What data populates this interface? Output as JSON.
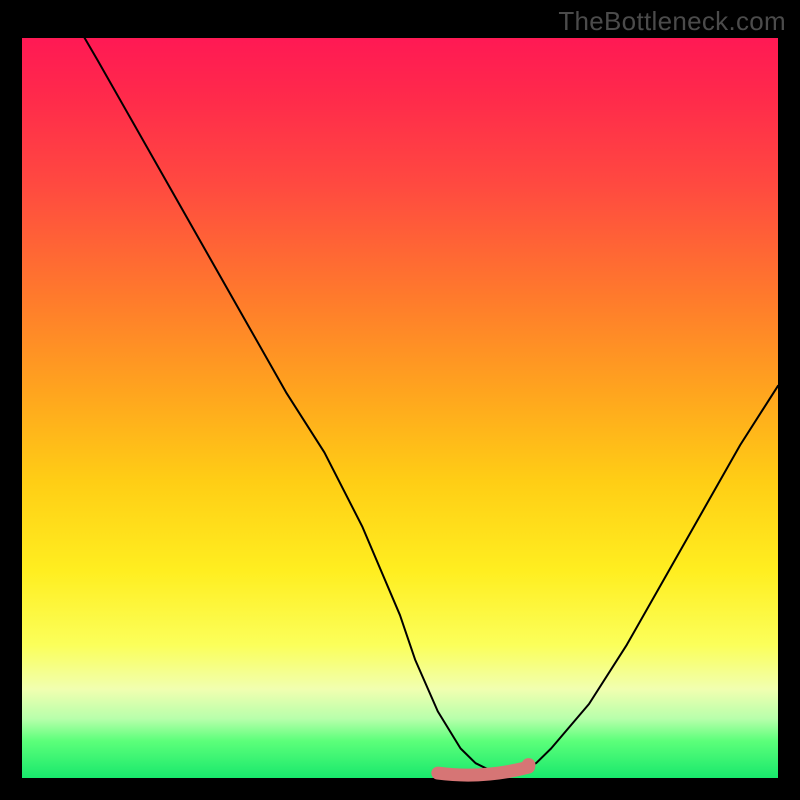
{
  "watermark": "TheBottleneck.com",
  "colors": {
    "gradient_top": "#ff1954",
    "gradient_mid": "#ffce15",
    "gradient_bottom": "#18e86c",
    "curve": "#000000",
    "plateau": "#d67575",
    "frame": "#000000"
  },
  "chart_data": {
    "type": "line",
    "title": "",
    "xlabel": "",
    "ylabel": "",
    "xlim": [
      0,
      100
    ],
    "ylim": [
      0,
      100
    ],
    "x": [
      6,
      10,
      15,
      20,
      25,
      30,
      35,
      40,
      45,
      50,
      52,
      55,
      58,
      60,
      62,
      64,
      65,
      68,
      70,
      75,
      80,
      85,
      90,
      95,
      100
    ],
    "y": [
      104,
      97,
      88,
      79,
      70,
      61,
      52,
      44,
      34,
      22,
      16,
      9,
      4,
      2,
      1,
      1,
      1,
      2,
      4,
      10,
      18,
      27,
      36,
      45,
      53
    ],
    "plateau_range_x": [
      55,
      67
    ],
    "notes": "V-shaped bottleneck curve. Y≈100 means severe bottleneck (red), Y≈0 means optimal (green). Flat pink segment marks the optimal zone near x≈55–67."
  }
}
